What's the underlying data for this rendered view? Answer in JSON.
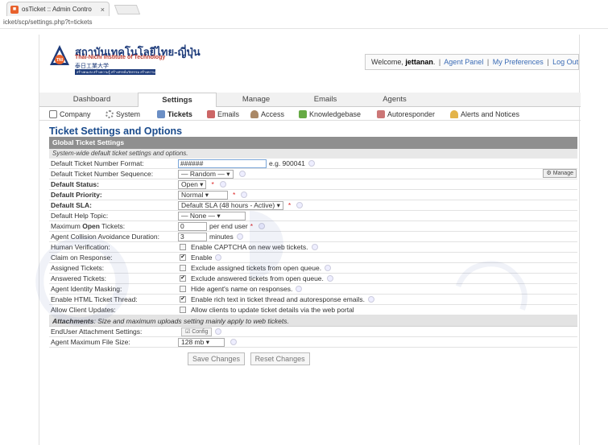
{
  "browser": {
    "tab_title": "osTicket :: Admin Contro",
    "tab_close": "×",
    "address": "icket/scp/settings.php?t=tickets"
  },
  "header": {
    "logo_line1": "สถาบันเทคโนโลยีไทย-ญี่ปุ่น",
    "logo_line2": "Thai-Nichi Institute of Technology",
    "logo_line3": "泰日工業大学",
    "logo_line4": "สร้างคนเก่ง สร้างความรู้ สร้างสรรค์นวัตกรรม สร้างความสำเร็จ",
    "emblem_text": "TNI",
    "welcome_prefix": "Welcome,",
    "username": "jettanan",
    "sep": "|",
    "link_agent_panel": "Agent Panel",
    "link_preferences": "My Preferences",
    "link_logout": "Log Out"
  },
  "nav": {
    "dashboard": "Dashboard",
    "settings": "Settings",
    "manage": "Manage",
    "emails": "Emails",
    "agents": "Agents"
  },
  "subnav": {
    "company": "Company",
    "system": "System",
    "tickets": "Tickets",
    "emails": "Emails",
    "access": "Access",
    "knowledgebase": "Knowledgebase",
    "autoresponder": "Autoresponder",
    "alerts": "Alerts and Notices"
  },
  "page_title": "Ticket Settings and Options",
  "section_header": "Global Ticket Settings",
  "section_desc": "System-wide default ticket settings and options.",
  "fields": {
    "number_format_label": "Default Ticket Number Format:",
    "number_format_value": "######",
    "number_format_example": "e.g. 900041",
    "sequence_label": "Default Ticket Number Sequence:",
    "sequence_value": "— Random —",
    "manage_button": "⚙ Manage",
    "status_label": "Default Status:",
    "status_value": "Open",
    "priority_label": "Default Priority:",
    "priority_value": "Normal",
    "sla_label": "Default SLA:",
    "sla_value": "Default SLA (48 hours - Active)",
    "help_topic_label": "Default Help Topic:",
    "help_topic_value": "— None —",
    "max_open_label_pre": "Maximum",
    "max_open_label_bold": "Open",
    "max_open_label_post": "Tickets:",
    "max_open_value": "0",
    "max_open_unit": "per end user",
    "collision_label": "Agent Collision Avoidance Duration:",
    "collision_value": "3",
    "collision_unit": "minutes",
    "human_label": "Human Verification:",
    "human_text": "Enable CAPTCHA on new web tickets.",
    "claim_label": "Claim on Response:",
    "claim_text": "Enable",
    "assigned_label": "Assigned Tickets:",
    "assigned_text": "Exclude assigned tickets from open queue.",
    "answered_label": "Answered Tickets:",
    "answered_text": "Exclude answered tickets from open queue.",
    "masking_label": "Agent Identity Masking:",
    "masking_text": "Hide agent's name on responses.",
    "html_label": "Enable HTML Ticket Thread:",
    "html_text": "Enable rich text in ticket thread and autoresponse emails.",
    "client_label": "Allow Client Updates:",
    "client_text": "Allow clients to update ticket details via the web portal",
    "attach_bold": "Attachments",
    "attach_text": ": Size and maximum uploads setting mainly apply to web tickets.",
    "enduser_label": "EndUser Attachment Settings:",
    "config_button": "☑ Config",
    "filesize_label": "Agent Maximum File Size:",
    "filesize_value": "128 mb",
    "required_mark": "*"
  },
  "checkboxes": {
    "human": false,
    "claim": true,
    "assigned": false,
    "answered": true,
    "masking": false,
    "html": true,
    "client": false
  },
  "buttons": {
    "save": "Save Changes",
    "reset": "Reset Changes"
  },
  "colors": {
    "title_blue": "#1a4b8c",
    "section_gray": "#8f8f8f",
    "link_blue": "#3a6bb5",
    "required_red": "#dd2222"
  }
}
